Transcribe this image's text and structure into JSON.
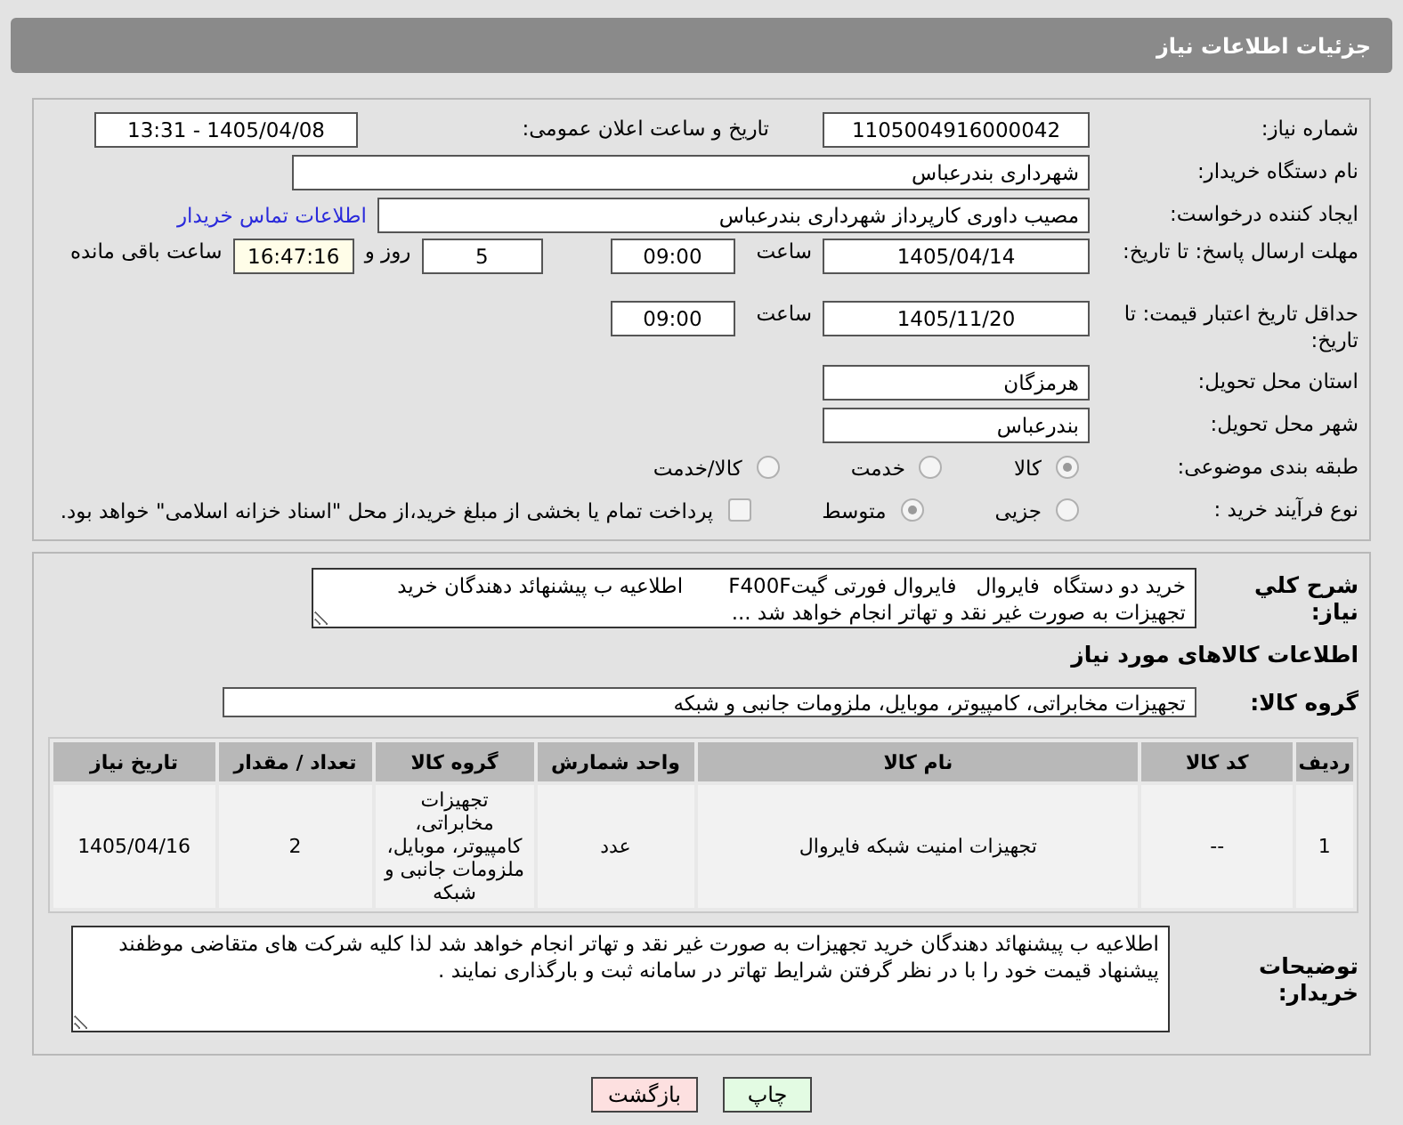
{
  "header": {
    "title": "جزئیات اطلاعات نیاز"
  },
  "need_number": {
    "label": "شماره نیاز:",
    "value": "1105004916000042"
  },
  "announce": {
    "label": "تاریخ و ساعت اعلان عمومی:",
    "value": "1405/04/08 - 13:31"
  },
  "buyer_org": {
    "label": "نام دستگاه خریدار:",
    "value": "شهرداری بندرعباس"
  },
  "requester": {
    "label": "ایجاد کننده درخواست:",
    "value": "مصیب داوری کارپرداز شهرداری بندرعباس",
    "link": "اطلاعات تماس خریدار"
  },
  "deadline": {
    "label": "مهلت ارسال پاسخ: تا تاریخ:",
    "date": "1405/04/14",
    "time_label": "ساعت",
    "time": "09:00",
    "days": "5",
    "days_label": "روز و",
    "remaining": "16:47:16",
    "remaining_label": "ساعت باقی مانده"
  },
  "validity": {
    "label": "حداقل تاریخ اعتبار قیمت: تا تاریخ:",
    "date": "1405/11/20",
    "time_label": "ساعت",
    "time": "09:00"
  },
  "province": {
    "label": "استان محل تحویل:",
    "value": "هرمزگان"
  },
  "city": {
    "label": "شهر محل تحویل:",
    "value": "بندرعباس"
  },
  "category": {
    "label": "طبقه بندی موضوعی:",
    "options": [
      {
        "label": "کالا",
        "selected": true
      },
      {
        "label": "خدمت",
        "selected": false
      },
      {
        "label": "کالا/خدمت",
        "selected": false
      }
    ]
  },
  "process": {
    "label": "نوع فرآیند خرید :",
    "options": [
      {
        "label": "جزیی",
        "selected": false
      },
      {
        "label": "متوسط",
        "selected": true
      }
    ],
    "payment": {
      "checked": false,
      "label": "پرداخت تمام یا بخشی از مبلغ خرید،از محل \"اسناد خزانه اسلامی\" خواهد بود."
    }
  },
  "description": {
    "label": "شرح کلي نیاز:",
    "value": "خرید دو دستگاه  فایروال   فایروال فورتی گیتF400F       اطلاعیه ب پیشنهائد دهندگان خرید تجهیزات به صورت غیر نقد و تهاتر انجام خواهد شد ..."
  },
  "goods_heading": "اطلاعات کالاهای مورد نیاز",
  "goods_group": {
    "label": "گروه کالا:",
    "value": "تجهیزات مخابراتی، کامپیوتر، موبایل، ملزومات جانبی و شبکه"
  },
  "table": {
    "columns": [
      "ردیف",
      "کد کالا",
      "نام کالا",
      "واحد شمارش",
      "گروه کالا",
      "تعداد / مقدار",
      "تاریخ نیاز"
    ],
    "rows": [
      [
        "1",
        "--",
        "تجهیزات امنیت شبکه فایروال",
        "عدد",
        "تجهیزات مخابراتی، کامپیوتر، موبایل، ملزومات جانبی و شبکه",
        "2",
        "1405/04/16"
      ]
    ]
  },
  "buyer_notes": {
    "label": "توضیحات خریدار:",
    "value": "اطلاعیه ب پیشنهائد دهندگان خرید تجهیزات به صورت غیر نقد و تهاتر انجام خواهد شد لذا کلیه شرکت های متقاضی موظفند پیشنهاد قیمت خود را با در نظر گرفتن شرایط تهاتر در سامانه ثبت و بارگذاری نمایند ."
  },
  "buttons": [
    {
      "label": "چاپ",
      "kind": "print"
    },
    {
      "label": "بازگشت",
      "kind": "back"
    }
  ]
}
